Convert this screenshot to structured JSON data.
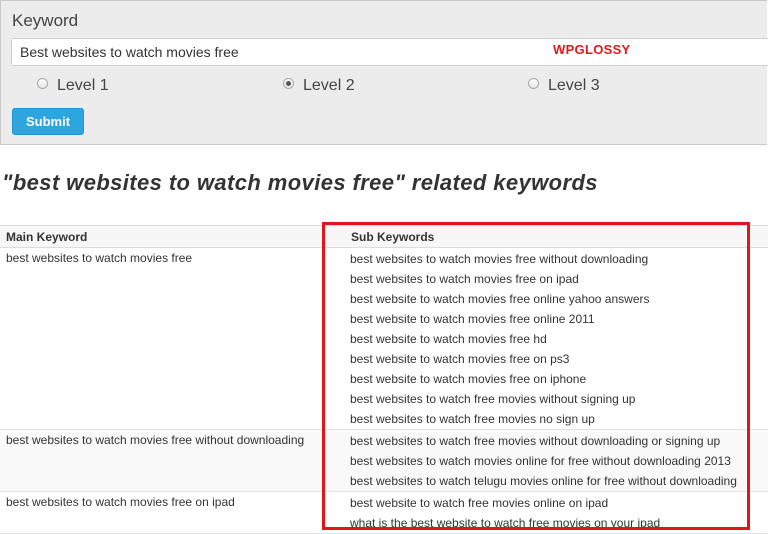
{
  "form": {
    "keyword_label": "Keyword",
    "keyword_value": "Best websites to watch movies free",
    "watermark": "WPGLOSSY",
    "levels": [
      {
        "label": "Level 1",
        "checked": false
      },
      {
        "label": "Level 2",
        "checked": true
      },
      {
        "label": "Level 3",
        "checked": false
      }
    ],
    "submit_label": "Submit"
  },
  "results": {
    "heading": "\"best websites to watch movies free\" related keywords",
    "col_main": "Main Keyword",
    "col_sub": "Sub Keywords",
    "rows": [
      {
        "main": "best websites to watch movies free",
        "subs": [
          "best websites to watch movies free without downloading",
          "best websites to watch movies free on ipad",
          "best website to watch movies free online yahoo answers",
          "best website to watch movies free online 2011",
          "best website to watch movies free hd",
          "best website to watch movies free on ps3",
          "best website to watch movies free on iphone",
          "best websites to watch free movies without signing up",
          "best websites to watch free movies no sign up"
        ]
      },
      {
        "main": "best websites to watch movies free without downloading",
        "subs": [
          "best websites to watch free movies without downloading or signing up",
          "best websites to watch movies online for free without downloading 2013",
          "best websites to watch telugu movies online for free without downloading"
        ]
      },
      {
        "main": "best websites to watch movies free on ipad",
        "subs": [
          "best website to watch free movies online on ipad",
          "what is the best website to watch free movies on your ipad"
        ]
      }
    ]
  },
  "colors": {
    "submit": "#2da5de",
    "watermark": "#e0191c",
    "highlight_box": "#e3151c"
  }
}
